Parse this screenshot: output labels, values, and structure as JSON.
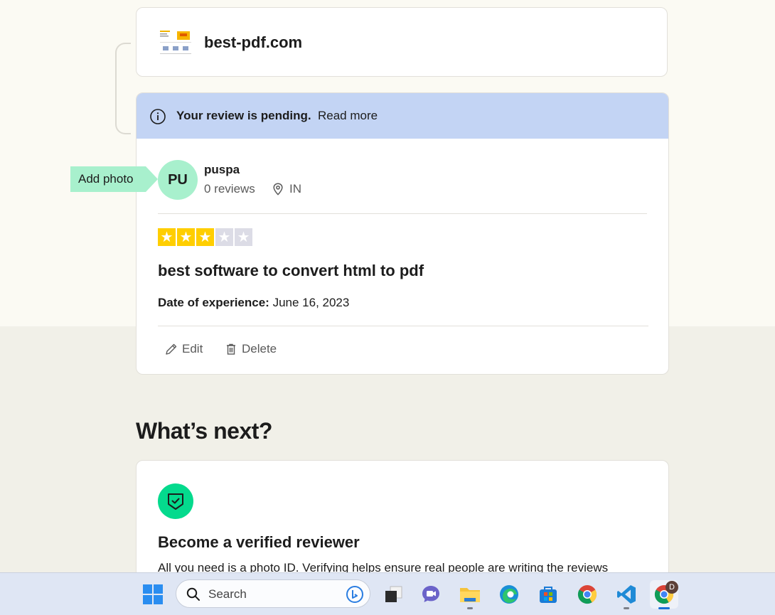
{
  "company": {
    "name": "best-pdf.com"
  },
  "pending": {
    "message": "Your review is pending.",
    "link": "Read more"
  },
  "user": {
    "initials": "PU",
    "name": "puspa",
    "reviews": "0 reviews",
    "country": "IN"
  },
  "tooltip": {
    "add_photo": "Add photo"
  },
  "review": {
    "rating": 3,
    "rating_max": 5,
    "title": "best software to convert html to pdf",
    "date_label": "Date of experience:",
    "date_value": "June 16, 2023"
  },
  "actions": {
    "edit": "Edit",
    "delete": "Delete"
  },
  "next": {
    "heading": "What’s next?",
    "card_title": "Become a verified reviewer",
    "card_text": "All you need is a photo ID. Verifying helps ensure real people are writing the reviews"
  },
  "taskbar": {
    "search_placeholder": "Search",
    "chrome_profile_badge": "D"
  },
  "colors": {
    "pending_bg": "#c3d4f4",
    "avatar_bg": "#a8f0cd",
    "star_on": "#ffce00",
    "star_off": "#dcdce6",
    "verify_green": "#04da8d"
  }
}
